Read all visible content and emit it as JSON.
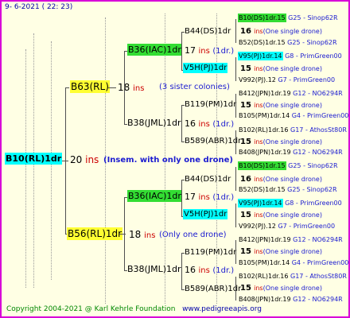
{
  "header_date": "9-  6-2021 ( 22: 23)",
  "footer": {
    "copyright": "Copyright 2004-2021 @ Karl Kehrle Foundation",
    "url": "www.pedigreeapis.org"
  },
  "root": {
    "name": "B10(RL)1dr",
    "ins_num": "20",
    "ins_word": "ins",
    "note": "(Insem. with only one drone)"
  },
  "dam": {
    "name": "B63(RL)",
    "ins_num": "18",
    "ins_word": "ins",
    "note": "(3 sister colonies)"
  },
  "sire": {
    "name": "B56(RL)1dr",
    "ins_num": "18",
    "ins_word": "ins",
    "note": "(Only one drone)"
  },
  "top": {
    "a": {
      "name": "B36(IAC)1dr",
      "ins_num": "17",
      "ins_word": "ins",
      "note": "(1dr.)"
    },
    "b": {
      "name": "B38(JML)1dr",
      "ins_num": "16",
      "ins_word": "ins",
      "note": "(1dr.)"
    },
    "a1": "B44(DS)1dr",
    "a2": "V5H(PJ)1dr",
    "b1": "B119(PM)1dr",
    "b2": "B589(ABR)1dr",
    "r1": {
      "left": "B10(DS)1dr.15",
      "right": "G25 - Sinop62R"
    },
    "r2": {
      "num": "16",
      "ins": "ins",
      "note": "(One single drone)"
    },
    "r3": {
      "left": "B52(DS)1dr.15",
      "right": "G25 - Sinop62R"
    },
    "r4": {
      "left": "V95(PJ)1dr.14",
      "right": "G8 - PrimGreen00"
    },
    "r5": {
      "num": "15",
      "ins": "ins",
      "note": "(One single drone)"
    },
    "r6": {
      "left": "V992(PJ).12",
      "right": "G7 - PrimGreen00"
    },
    "r7": {
      "left": "B412(JPN)1dr.19",
      "right": "G12 - NO6294R"
    },
    "r8": {
      "num": "15",
      "ins": "ins",
      "note": "(One single drone)"
    },
    "r9": {
      "left": "B105(PM)1dr.14",
      "right": "G4 - PrimGreen00"
    },
    "r10": {
      "left": "B102(RL)1dr.16",
      "right": "G17 - AthosSt80R"
    },
    "r11": {
      "num": "15",
      "ins": "ins",
      "note": "(One single drone)"
    },
    "r12": {
      "left": "B408(JPN)1dr.19",
      "right": "G12 - NO6294R"
    }
  },
  "bottom": {
    "a": {
      "name": "B36(IAC)1dr",
      "ins_num": "17",
      "ins_word": "ins",
      "note": "(1dr.)"
    },
    "b": {
      "name": "B38(JML)1dr",
      "ins_num": "16",
      "ins_word": "ins",
      "note": "(1dr.)"
    },
    "a1": "B44(DS)1dr",
    "a2": "V5H(PJ)1dr",
    "b1": "B119(PM)1dr",
    "b2": "B589(ABR)1dr",
    "r1": {
      "left": "B10(DS)1dr.15",
      "right": "G25 - Sinop62R"
    },
    "r2": {
      "num": "16",
      "ins": "ins",
      "note": "(One single drone)"
    },
    "r3": {
      "left": "B52(DS)1dr.15",
      "right": "G25 - Sinop62R"
    },
    "r4": {
      "left": "V95(PJ)1dr.14",
      "right": "G8 - PrimGreen00"
    },
    "r5": {
      "num": "15",
      "ins": "ins",
      "note": "(One single drone)"
    },
    "r6": {
      "left": "V992(PJ).12",
      "right": "G7 - PrimGreen00"
    },
    "r7": {
      "left": "B412(JPN)1dr.19",
      "right": "G12 - NO6294R"
    },
    "r8": {
      "num": "15",
      "ins": "ins",
      "note": "(One single drone)"
    },
    "r9": {
      "left": "B105(PM)1dr.14",
      "right": "G4 - PrimGreen00"
    },
    "r10": {
      "left": "B102(RL)1dr.16",
      "right": "G17 - AthosSt80R"
    },
    "r11": {
      "num": "15",
      "ins": "ins",
      "note": "(One single drone)"
    },
    "r12": {
      "left": "B408(JPN)1dr.19",
      "right": "G12 - NO6294R"
    }
  }
}
